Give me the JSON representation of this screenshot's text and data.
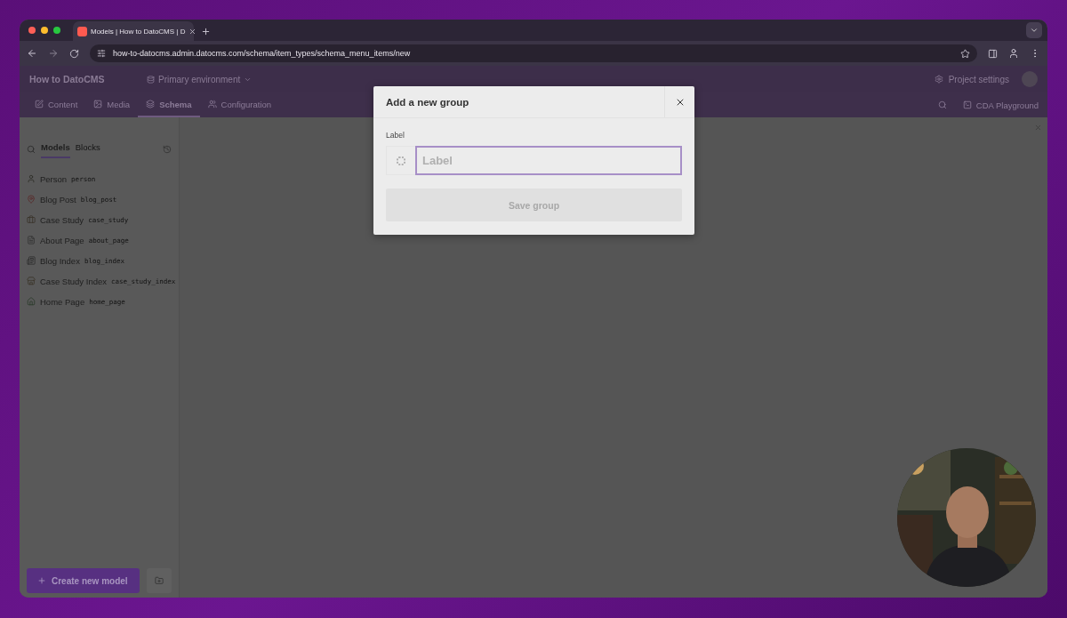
{
  "browser": {
    "tabs": [
      {
        "title": "Models | How to DatoCMS | D",
        "selected": true
      }
    ],
    "url": "how-to-datocms.admin.datocms.com/schema/item_types/schema_menu_items/new"
  },
  "app": {
    "project": "How to DatoCMS",
    "environment": "Primary environment",
    "project_settings": "Project settings",
    "nav": [
      {
        "label": "Content",
        "selected": false
      },
      {
        "label": "Media",
        "selected": false
      },
      {
        "label": "Schema",
        "selected": true
      },
      {
        "label": "Configuration",
        "selected": false
      }
    ],
    "cda_playground": "CDA Playground"
  },
  "sidebar": {
    "tabs": [
      {
        "label": "Models",
        "selected": true
      },
      {
        "label": "Blocks",
        "selected": false
      }
    ],
    "models": [
      {
        "name": "Person",
        "api_key": "person"
      },
      {
        "name": "Blog Post",
        "api_key": "blog_post"
      },
      {
        "name": "Case Study",
        "api_key": "case_study"
      },
      {
        "name": "About Page",
        "api_key": "about_page"
      },
      {
        "name": "Blog Index",
        "api_key": "blog_index"
      },
      {
        "name": "Case Study Index",
        "api_key": "case_study_index"
      },
      {
        "name": "Home Page",
        "api_key": "home_page"
      }
    ],
    "create_button": "Create new model"
  },
  "modal": {
    "title": "Add a new group",
    "field_label": "Label",
    "placeholder": "Label",
    "button": {
      "label": "Save group",
      "disabled": true
    }
  }
}
